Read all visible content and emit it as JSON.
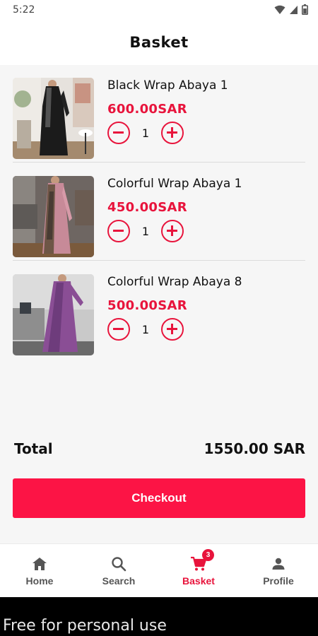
{
  "status_bar": {
    "time": "5:22"
  },
  "header": {
    "title": "Basket"
  },
  "items": [
    {
      "name": "Black Wrap Abaya 1",
      "price": "600.00SAR",
      "quantity": "1"
    },
    {
      "name": "Colorful Wrap Abaya 1",
      "price": "450.00SAR",
      "quantity": "1"
    },
    {
      "name": "Colorful Wrap Abaya 8",
      "price": "500.00SAR",
      "quantity": "1"
    }
  ],
  "summary": {
    "total_label": "Total",
    "total_value": "1550.00 SAR"
  },
  "checkout": {
    "label": "Checkout"
  },
  "nav": {
    "items": [
      {
        "label": "Home",
        "icon": "home-icon"
      },
      {
        "label": "Search",
        "icon": "search-icon"
      },
      {
        "label": "Basket",
        "icon": "cart-icon",
        "badge": "3",
        "active": true
      },
      {
        "label": "Profile",
        "icon": "person-icon"
      }
    ]
  },
  "colors": {
    "accent": "#e8143c",
    "button": "#fc1445",
    "background": "#f6f6f6"
  },
  "watermark": {
    "text": "Free for personal use"
  }
}
